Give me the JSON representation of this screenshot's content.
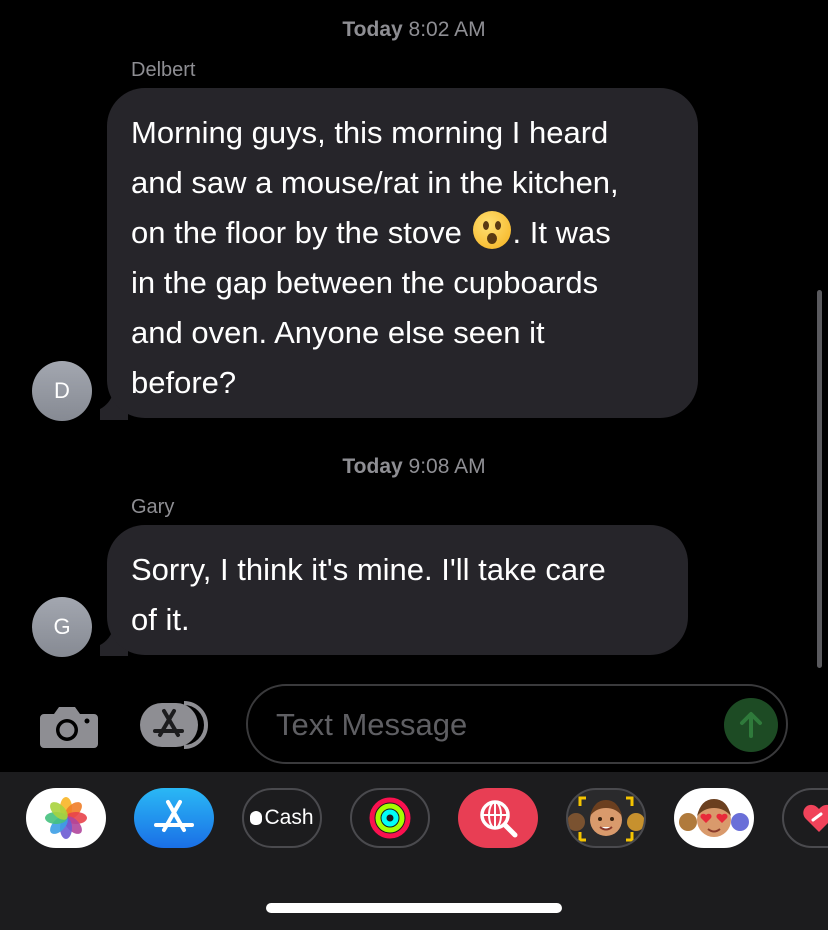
{
  "conversation": {
    "groups": [
      {
        "timestamp_day": "Today",
        "timestamp_time": "8:02 AM",
        "sender": "Delbert",
        "avatar_initial": "D",
        "message_before_emoji": "Morning guys, this morning I heard\nand saw a mouse/rat in the kitchen,\non the floor by the stove",
        "emoji": "hushed-face",
        "message_after_emoji": ". It was\nin the gap between the cupboards\nand oven. Anyone else seen it\nbefore?"
      },
      {
        "timestamp_day": "Today",
        "timestamp_time": "9:08 AM",
        "sender": "Gary",
        "avatar_initial": "G",
        "message": "Sorry, I think it's mine. I'll take care\nof it."
      }
    ]
  },
  "composer": {
    "placeholder": "Text Message",
    "camera_icon": "camera-icon",
    "apps_icon": "app-store-icon",
    "send_icon": "arrow-up-icon"
  },
  "app_drawer": {
    "apps": [
      {
        "name": "photos-app",
        "icon": "photos-flower-icon"
      },
      {
        "name": "app-store-app",
        "icon": "app-store-icon"
      },
      {
        "name": "apple-cash-app",
        "label": "Cash"
      },
      {
        "name": "fitness-app",
        "icon": "activity-rings-icon"
      },
      {
        "name": "images-search-app",
        "icon": "globe-search-icon"
      },
      {
        "name": "memoji-stickers-app",
        "icon": "memoji-icon"
      },
      {
        "name": "memoji-app",
        "icon": "memoji-heart-eyes-icon"
      },
      {
        "name": "digital-touch-app",
        "icon": "heart-icon"
      }
    ]
  },
  "colors": {
    "background": "#000000",
    "bubble": "#26252a",
    "drawer": "#1c1c1e",
    "muted_text": "#8e8e93",
    "send_button": "#1d4b24"
  }
}
